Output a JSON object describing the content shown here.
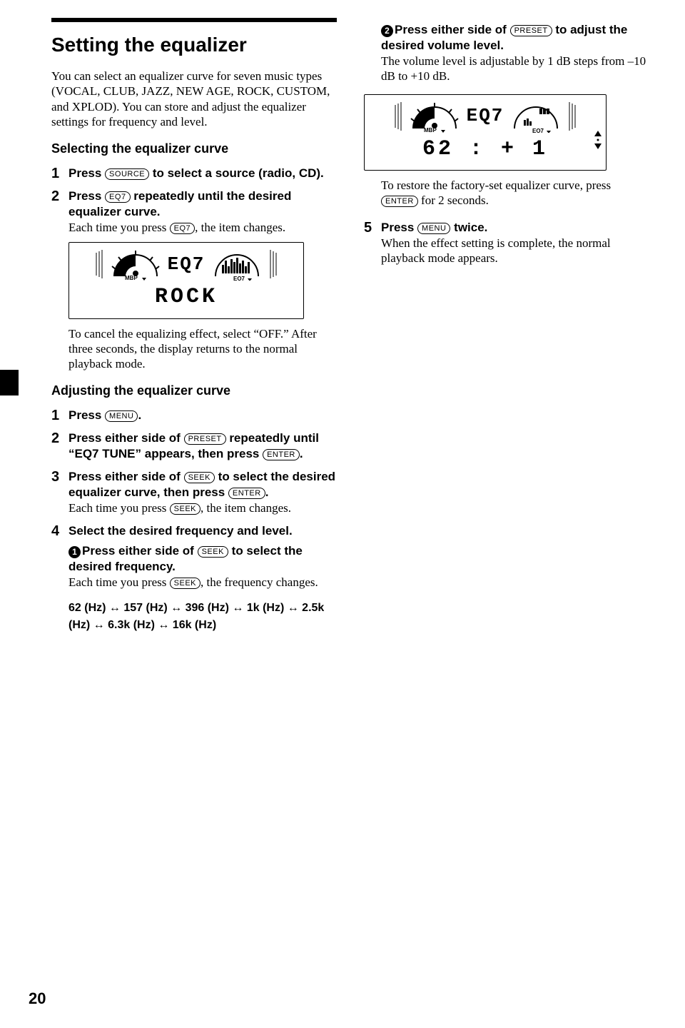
{
  "page_number": "20",
  "title": "Setting the equalizer",
  "intro": "You can select an equalizer curve for seven music types (VOCAL, CLUB, JAZZ, NEW AGE, ROCK, CUSTOM, and XPLOD). You can store and adjust the equalizer settings for frequency and level.",
  "section1_h": "Selecting the equalizer curve",
  "s1_step1_a": "Press ",
  "btn_source": "SOURCE",
  "s1_step1_b": " to select a source (radio, CD).",
  "s1_step2_a": "Press ",
  "btn_eq7": "EQ7",
  "s1_step2_b": " repeatedly until the desired equalizer curve.",
  "s1_step2_note_a": "Each time you press ",
  "s1_step2_note_b": ", the item changes.",
  "lcd1_eq": "EQ7",
  "lcd1_mbp": "MBP",
  "lcd1_eq7": "EQ7",
  "lcd1_text": "ROCK",
  "s1_after": "To cancel the equalizing effect, select “OFF.” After three seconds, the display returns to the normal playback mode.",
  "section2_h": "Adjusting the equalizer curve",
  "s2_step1_a": "Press ",
  "btn_menu": "MENU",
  "s2_step1_b": ".",
  "s2_step2_a": "Press either side of ",
  "btn_preset": "PRESET",
  "s2_step2_b": " repeatedly until “EQ7 TUNE” appears, then press ",
  "btn_enter": "ENTER",
  "s2_step2_c": ".",
  "s2_step3_a": "Press either side of ",
  "btn_seek": "SEEK",
  "s2_step3_b": " to select the desired equalizer curve, then press ",
  "s2_step3_c": ".",
  "s2_step3_note_a": "Each time you press ",
  "s2_step3_note_b": ", the item changes.",
  "s2_step4": "Select the desired frequency and level.",
  "sub1_a": "Press either side of ",
  "sub1_b": " to select the desired frequency.",
  "sub1_note_a": "Each time you press ",
  "sub1_note_b": ", the frequency changes.",
  "freq": "62 (Hz) ↔ 157 (Hz) ↔ 396 (Hz) ↔ 1k (Hz) ↔ 2.5k (Hz) ↔ 6.3k (Hz) ↔ 16k (Hz)",
  "col2_sub2_a": "Press either side of ",
  "col2_sub2_b": " to adjust the desired volume level.",
  "col2_sub2_note": "The volume level is adjustable by 1 dB steps from –10 dB to +10 dB.",
  "lcd2_eq": "EQ7",
  "lcd2_text": "62 : +  1",
  "col2_restore_a": "To restore the factory-set equalizer curve, press ",
  "col2_restore_b": " for 2 seconds.",
  "s2_step5_a": "Press ",
  "s2_step5_b": " twice.",
  "s2_step5_note": "When the effect setting is complete, the normal playback mode appears."
}
